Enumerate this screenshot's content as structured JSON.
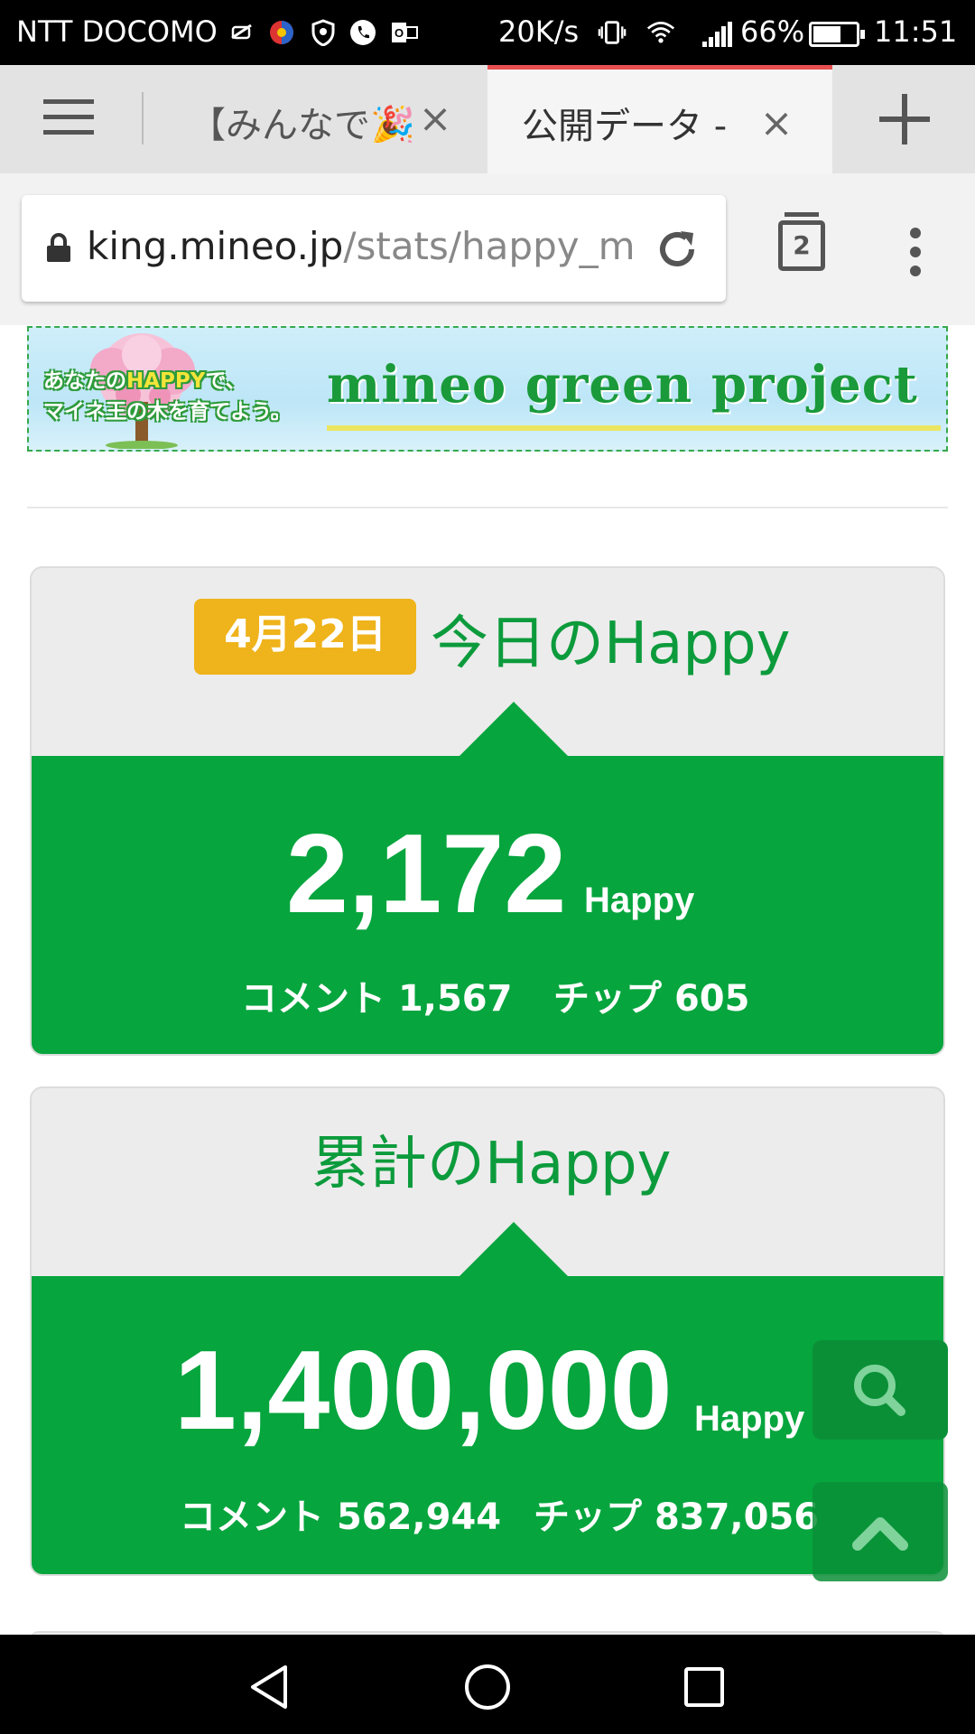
{
  "status_bar": {
    "carrier": "NTT DOCOMO",
    "net_speed": "20K/s",
    "battery_percent": "66%",
    "battery_level": 0.66,
    "time": "11:51",
    "icons": [
      "muted-notification-icon",
      "app-icon",
      "shield-icon",
      "phone-icon",
      "outlook-icon",
      "vibrate-icon",
      "wifi-icon",
      "signal-icon",
      "battery-icon"
    ]
  },
  "tabs": [
    {
      "title": "【みんなで🎉",
      "active": false
    },
    {
      "title": "公開データ -",
      "active": true
    }
  ],
  "toolbar": {
    "url_host": "king.mineo.jp",
    "url_path": "/stats/happy_m",
    "tab_count": "2"
  },
  "banner": {
    "catch_line1_pre": "あなたの",
    "catch_line1_hap": "HAPPY",
    "catch_line1_post": "で、",
    "catch_line2": "マイネ王の木を育てよう。",
    "logo": "mineo green project"
  },
  "today": {
    "date": "4月22日",
    "title": "今日のHappy",
    "total": "2,172",
    "unit": "Happy",
    "comment_label": "コメント",
    "comment_value": "1,567",
    "tip_label": "チップ",
    "tip_value": "605"
  },
  "cumulative": {
    "title": "累計のHappy",
    "total": "1,400,000",
    "unit": "Happy",
    "comment_label": "コメント",
    "comment_value": "562,944",
    "tip_label": "チップ",
    "tip_value": "837,056"
  },
  "colors": {
    "accent_green": "#06a53e",
    "title_green": "#0c9b3c",
    "badge_yellow": "#efb31b",
    "tab_indicator": "#e84f50"
  }
}
